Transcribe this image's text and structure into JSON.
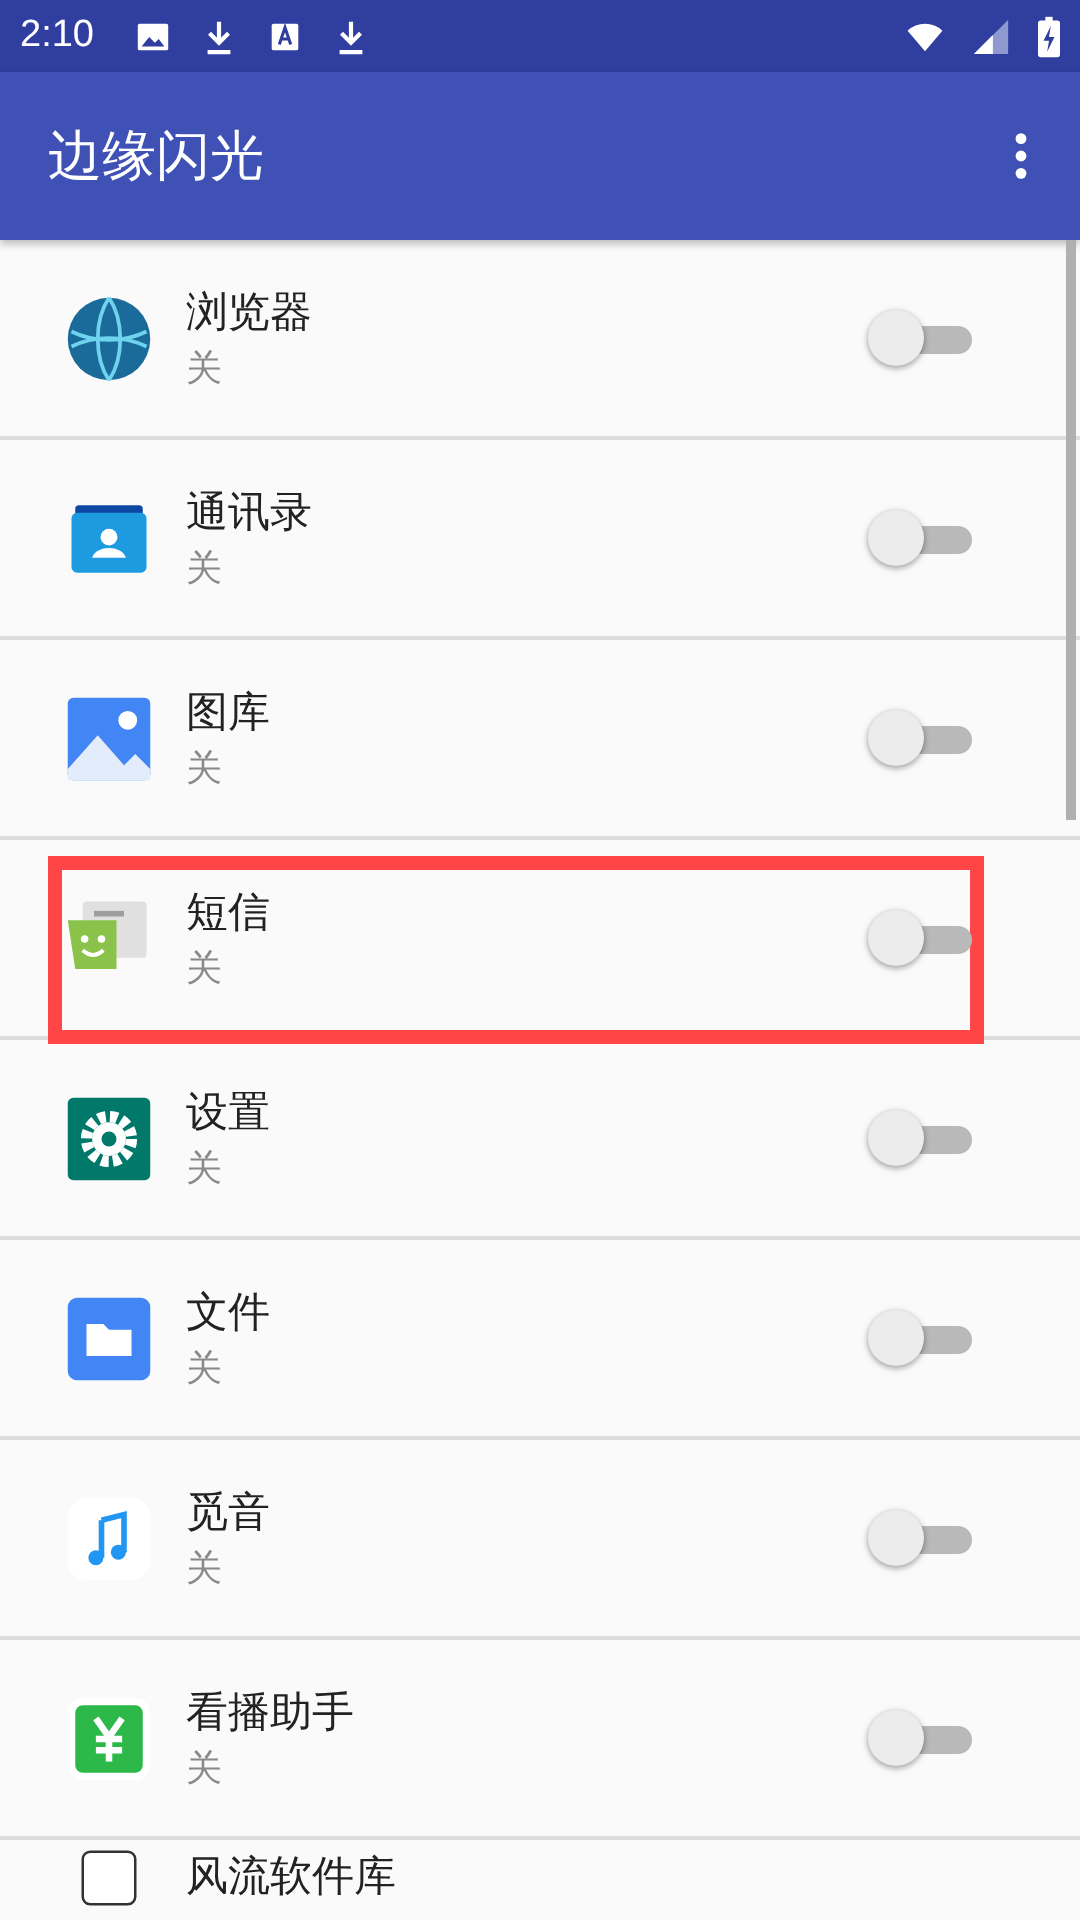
{
  "status_bar": {
    "time": "2:10"
  },
  "app_bar": {
    "title": "边缘闪光"
  },
  "apps": [
    {
      "name": "浏览器",
      "state": "关",
      "on": false,
      "highlighted": false
    },
    {
      "name": "通讯录",
      "state": "关",
      "on": false,
      "highlighted": false
    },
    {
      "name": "图库",
      "state": "关",
      "on": false,
      "highlighted": false
    },
    {
      "name": "短信",
      "state": "关",
      "on": false,
      "highlighted": true
    },
    {
      "name": "设置",
      "state": "关",
      "on": false,
      "highlighted": false
    },
    {
      "name": "文件",
      "state": "关",
      "on": false,
      "highlighted": false
    },
    {
      "name": "觅音",
      "state": "关",
      "on": false,
      "highlighted": false
    },
    {
      "name": "看播助手",
      "state": "关",
      "on": false,
      "highlighted": false
    },
    {
      "name": "风流软件库",
      "highlighted": false
    }
  ]
}
